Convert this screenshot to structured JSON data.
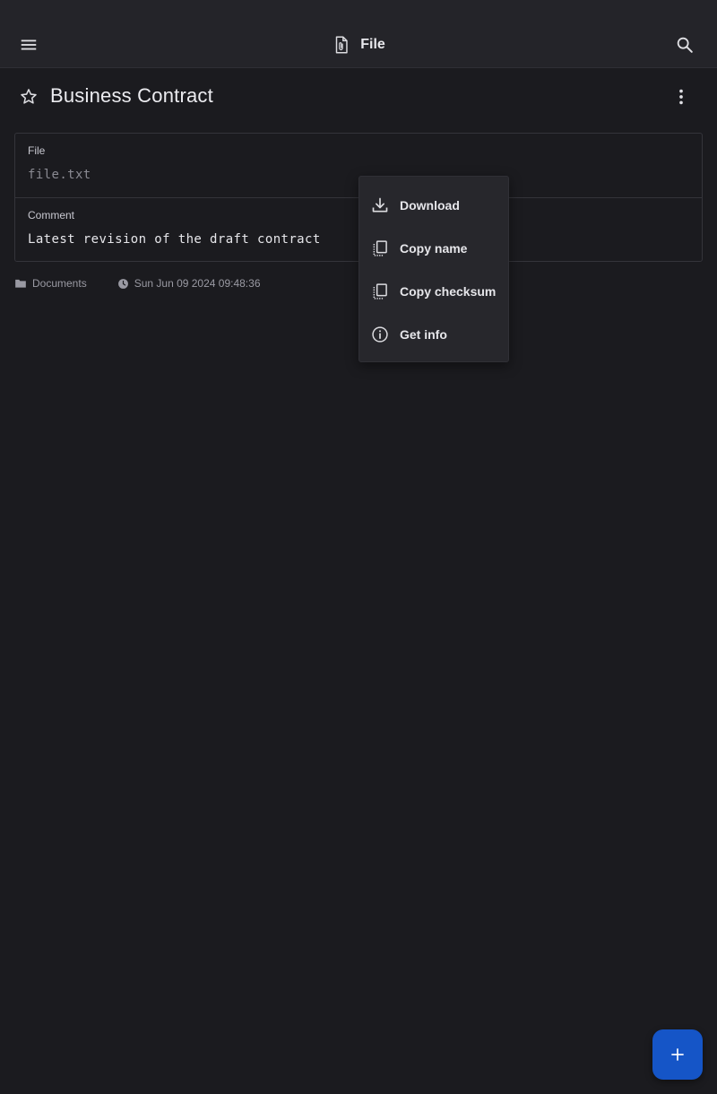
{
  "appbar": {
    "title": "File",
    "menu_icon": "menu-icon",
    "title_icon": "file-attachment-icon",
    "search_icon": "search-icon"
  },
  "document": {
    "title": "Business Contract",
    "favorite_icon": "star-outline-icon",
    "more_icon": "more-vertical-icon"
  },
  "fields": [
    {
      "label": "File",
      "value": "file.txt",
      "is_placeholder": true
    },
    {
      "label": "Comment",
      "value": "Latest revision of the draft contract",
      "is_placeholder": false
    }
  ],
  "meta": {
    "folder": "Documents",
    "folder_icon": "folder-icon",
    "timestamp": "Sun Jun 09 2024 09:48:36",
    "timestamp_icon": "clock-icon"
  },
  "context_menu": {
    "items": [
      {
        "label": "Download",
        "icon": "download-icon"
      },
      {
        "label": "Copy name",
        "icon": "copy-icon"
      },
      {
        "label": "Copy checksum",
        "icon": "copy-icon"
      },
      {
        "label": "Get info",
        "icon": "info-icon"
      }
    ]
  },
  "fab": {
    "icon": "plus-icon"
  },
  "colors": {
    "background": "#1b1b1f",
    "appbar": "#242429",
    "menu": "#27272c",
    "fab": "#1555c7",
    "text": "#e4e4e8",
    "muted_text": "#9a9aa3"
  }
}
